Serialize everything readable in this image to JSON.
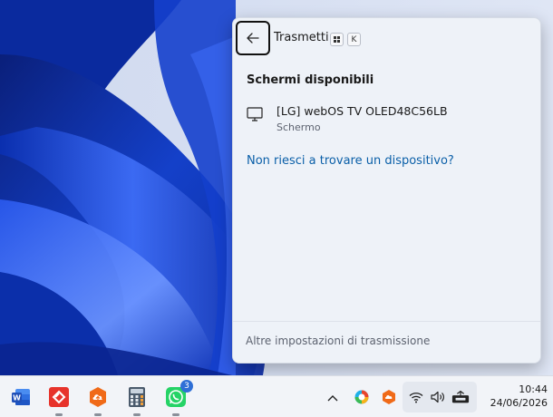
{
  "flyout": {
    "title": "Trasmetti",
    "shortcut_key": "K",
    "section_title": "Schermi disponibili",
    "devices": [
      {
        "name": "[LG] webOS TV OLED48C56LB",
        "type": "Schermo"
      }
    ],
    "help_link": "Non riesci a trovare un dispositivo?",
    "footer_link": "Altre impostazioni di trasmissione"
  },
  "taskbar": {
    "apps": [
      {
        "icon": "word-icon",
        "color": "#1f5bd1"
      },
      {
        "icon": "anydesk-icon",
        "color": "#e7332b"
      },
      {
        "icon": "cloud-upload-icon",
        "color": "#f06a18"
      },
      {
        "icon": "calculator-icon",
        "color": "#4a5a6c"
      },
      {
        "icon": "whatsapp-icon",
        "color": "#25d366",
        "badge": "3"
      }
    ],
    "tray": {
      "time": "10:44",
      "date": "24/06/2026"
    }
  },
  "colors": {
    "accent_link": "#0a5fa8",
    "flyout_bg": "#eef2f8",
    "wallpaper_dark": "#0b2a8f",
    "wallpaper_light": "#4f7fff"
  }
}
